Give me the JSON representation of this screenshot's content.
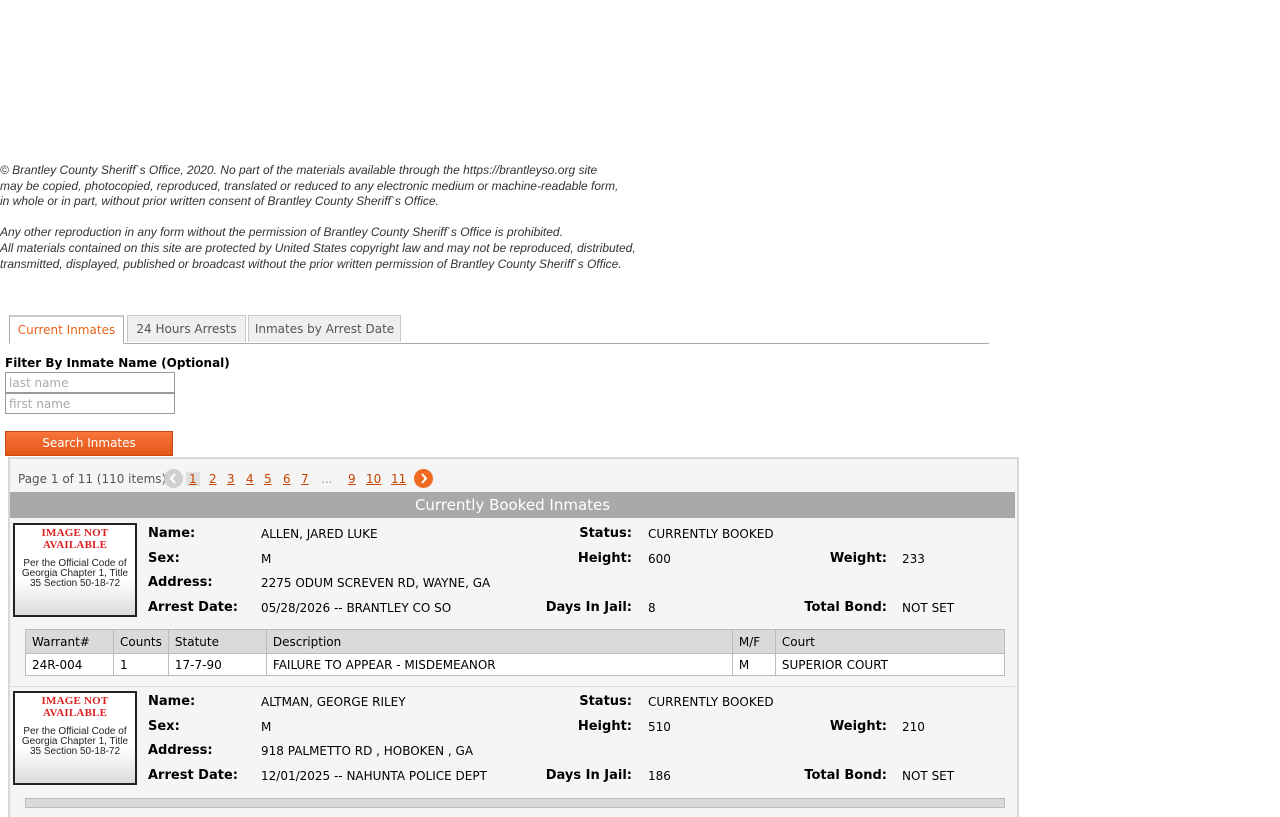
{
  "copyright": {
    "lines1": [
      "© Brantley County Sheriff`s Office, 2020. No part of the materials available through the https://brantleyso.org site",
      "may be copied, photocopied, reproduced, translated or reduced to any electronic medium or machine-readable form,",
      "in whole or in part, without prior written consent of Brantley County Sheriff`s Office."
    ],
    "lines2": [
      "Any other reproduction in any form without the permission of Brantley County Sheriff`s Office is prohibited.",
      "All materials contained on this site are protected by United States copyright law and may not be reproduced, distributed,",
      "transmitted, displayed, published or broadcast without the prior written permission of Brantley County Sheriff`s Office."
    ]
  },
  "tabs": [
    "Current Inmates",
    "24 Hours Arrests",
    "Inmates by Arrest Date"
  ],
  "filter": {
    "label": "Filter By Inmate Name (Optional)",
    "last_placeholder": "last name",
    "first_placeholder": "first name",
    "button": "Search Inmates"
  },
  "pager": {
    "info": "Page 1 of 11 (110 items)",
    "pages": [
      "1",
      "2",
      "3",
      "4",
      "5",
      "6",
      "7",
      "...",
      "9",
      "10",
      "11"
    ]
  },
  "list_title": "Currently Booked Inmates",
  "photo": {
    "na": "IMAGE NOT AVAILABLE",
    "note": "Per the Official Code of Georgia Chapter 1, Title 35 Section 50-18-72"
  },
  "labels": {
    "name": "Name:",
    "sex": "Sex:",
    "address": "Address:",
    "arrest_date": "Arrest Date:",
    "status": "Status:",
    "height": "Height:",
    "days": "Days In Jail:",
    "weight": "Weight:",
    "bond": "Total Bond:"
  },
  "warrant_headers": [
    "Warrant#",
    "Counts",
    "Statute",
    "Description",
    "M/F",
    "Court"
  ],
  "inmates": [
    {
      "name": "ALLEN, JARED LUKE",
      "sex": "M",
      "address": "2275 ODUM SCREVEN RD, WAYNE, GA",
      "arrest_date": "05/28/2026 -- BRANTLEY CO SO",
      "status": "CURRENTLY BOOKED",
      "height": "600",
      "days": "8",
      "weight": "233",
      "bond": "NOT SET",
      "warrants": [
        {
          "warrant": "24R-004",
          "counts": "1",
          "statute": "17-7-90",
          "description": "FAILURE TO APPEAR - MISDEMEANOR",
          "mf": "M",
          "court": "SUPERIOR COURT"
        }
      ]
    },
    {
      "name": "ALTMAN, GEORGE RILEY",
      "sex": "M",
      "address": "918 PALMETTO RD , HOBOKEN , GA",
      "arrest_date": "12/01/2025 -- NAHUNTA POLICE DEPT",
      "status": "CURRENTLY BOOKED",
      "height": "510",
      "days": "186",
      "weight": "210",
      "bond": "NOT SET",
      "warrants": []
    }
  ]
}
